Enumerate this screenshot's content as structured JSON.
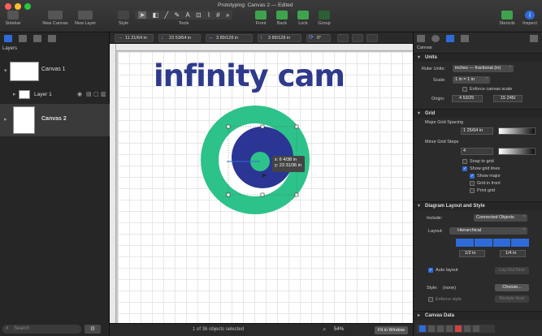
{
  "window": {
    "title": "Prototyping: Canvas 2 — Edited"
  },
  "toolbar": {
    "sidebar": "Sidebar",
    "new_canvas": "New Canvas",
    "new_layer": "New Layer",
    "style": "Style",
    "tools": "Tools",
    "front": "Front",
    "back": "Back",
    "lock": "Lock",
    "group": "Group",
    "stencils": "Stencils",
    "inspect": "Inspect"
  },
  "geometry": {
    "x": "11 21/64 in",
    "y": "23 53/64 in",
    "w": "3 89/128 in",
    "h": "3 89/128 in",
    "angle": "0°"
  },
  "sidebar": {
    "title": "Layers",
    "canvas1": "Canvas 1",
    "layer1": "Layer 1",
    "canvas2": "Canvas 2",
    "search_placeholder": "Search"
  },
  "canvas": {
    "heading": "infinity cam",
    "tooltip_x": "x: 6 4/38 in",
    "tooltip_y": "y: 23 31/36 in"
  },
  "status": {
    "selection": "1 of 36 objects selected",
    "zoom": "54%",
    "fit": "Fit in Window"
  },
  "inspector": {
    "header": "Canvas",
    "units": {
      "title": "Units",
      "ruler_label": "Ruler Units:",
      "ruler_value": "inches — fractional (in)",
      "scale_label": "Scale:",
      "scale_value": "1 in = 1 in",
      "enforce": "Enforce canvas scale",
      "origin_label": "Origin:",
      "origin_x": "4 53/25",
      "origin_y": "15 245/"
    },
    "grid": {
      "title": "Grid",
      "major_label": "Major Grid Spacing",
      "major_value": "1 25/64 in",
      "minor_label": "Minor Grid Steps",
      "minor_value": "4",
      "snap": "Snap to grid",
      "show_lines": "Show grid lines",
      "show_major": "Show major",
      "in_front": "Grid in front",
      "print": "Print grid"
    },
    "layout": {
      "title": "Diagram Layout and Style",
      "include_label": "Include:",
      "include_value": "Connected Objects",
      "layout_label": "Layout:",
      "layout_value": "Hierarchical",
      "spacing1": "1/2 in",
      "spacing2": "1/4 in",
      "auto": "Auto layout",
      "layout_now": "Lay Out Now",
      "style_label": "Style:",
      "style_value": "(none)",
      "choose": "Choose...",
      "enforce": "Enforce style",
      "restyle": "Restyle Now"
    },
    "canvas_data": {
      "title": "Canvas Data"
    }
  },
  "colors": {
    "ring": "#2dc28a",
    "disc": "#2b3594",
    "heading": "#2e3a8c",
    "accent": "#2f6bd8"
  }
}
